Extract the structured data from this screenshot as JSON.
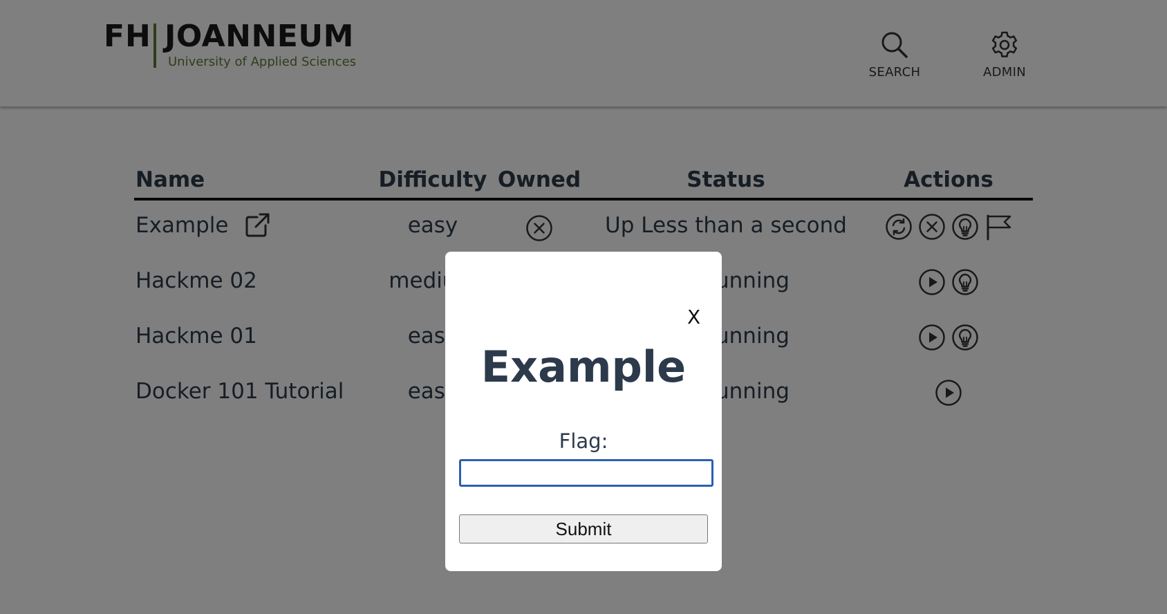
{
  "header": {
    "logo": {
      "abbr": "FH",
      "name": "JOANNEUM",
      "subtitle": "University of Applied Sciences"
    },
    "nav": [
      {
        "label": "SEARCH",
        "icon": "search-icon"
      },
      {
        "label": "ADMIN",
        "icon": "gear-icon"
      }
    ]
  },
  "table": {
    "columns": [
      "Name",
      "Difficulty",
      "Owned",
      "Status",
      "Actions"
    ],
    "rows": [
      {
        "name": "Example",
        "difficulty": "easy",
        "owned": "x-circle-icon",
        "status": "Up Less than a second",
        "actions": [
          "restart-icon",
          "stop-icon",
          "hint-icon",
          "flag-icon"
        ]
      },
      {
        "name": "Hackme 02",
        "difficulty": "medium",
        "owned": "",
        "status": "Not running",
        "actions": [
          "play-icon",
          "hint-icon"
        ]
      },
      {
        "name": "Hackme 01",
        "difficulty": "easy",
        "owned": "",
        "status": "Not running",
        "actions": [
          "play-icon",
          "hint-icon"
        ]
      },
      {
        "name": "Docker 101 Tutorial",
        "difficulty": "easy",
        "owned": "",
        "status": "Not running",
        "actions": [
          "play-icon"
        ]
      }
    ]
  },
  "modal": {
    "close_label": "X",
    "title": "Example",
    "flag_label": "Flag:",
    "flag_value": "",
    "submit_label": "Submit"
  },
  "colors": {
    "text": "#2c3a4b",
    "logo_green": "#5f7a37",
    "overlay": "rgba(0,0,0,0.5)",
    "input_focus": "#2b5fb3"
  }
}
